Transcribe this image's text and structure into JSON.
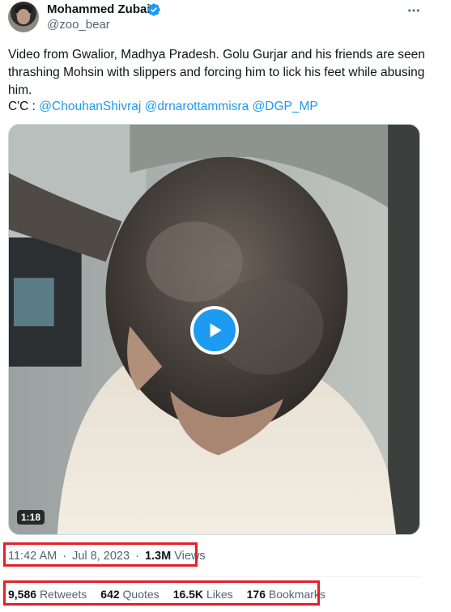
{
  "author": {
    "display_name": "Mohammed Zubair",
    "handle": "@zoo_bear",
    "verified_color": "#1d9bf0"
  },
  "tweet": {
    "text": "Video from Gwalior, Madhya Pradesh. Golu Gurjar and his friends are seen thrashing Mohsin with slippers and forcing him to lick his feet while abusing him.",
    "cc_prefix": "C'C :",
    "mentions": [
      "@ChouhanShivraj",
      "@drnarottammisra",
      "@DGP_MP"
    ]
  },
  "media": {
    "duration": "1:18",
    "play_icon": "play-icon"
  },
  "meta": {
    "time": "11:42 AM",
    "separator": "·",
    "date": "Jul 8, 2023",
    "views_count": "1.3M",
    "views_label": "Views"
  },
  "stats": [
    {
      "count": "9,586",
      "label": "Retweets"
    },
    {
      "count": "642",
      "label": "Quotes"
    },
    {
      "count": "16.5K",
      "label": "Likes"
    },
    {
      "count": "176",
      "label": "Bookmarks"
    }
  ],
  "colors": {
    "accent": "#1d9bf0",
    "annotation": "#e5202a",
    "secondary_text": "#536471"
  }
}
